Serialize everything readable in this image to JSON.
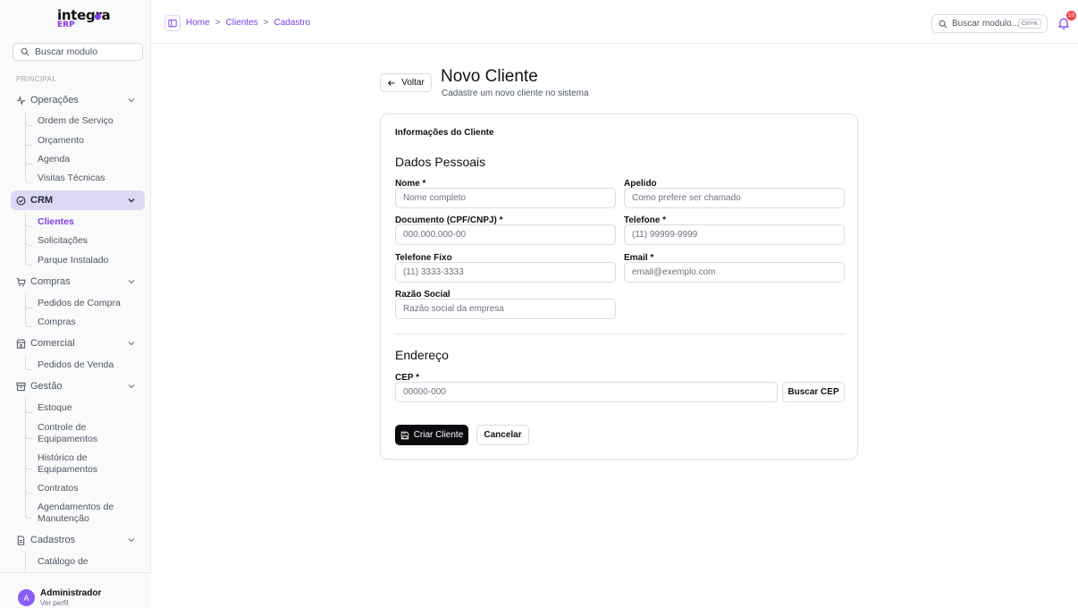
{
  "logo": {
    "name": "integra",
    "sub": "ERP"
  },
  "sidebar": {
    "search_placeholder": "Buscar modulo",
    "section_title": "PRINCIPAL",
    "groups": [
      {
        "label": "Operações",
        "icon": "activity-icon"
      },
      {
        "label": "CRM",
        "icon": "circle-check-icon"
      },
      {
        "label": "Compras",
        "icon": "cart-icon"
      },
      {
        "label": "Comercial",
        "icon": "store-icon"
      },
      {
        "label": "Gestão",
        "icon": "archive-icon"
      },
      {
        "label": "Cadastros",
        "icon": "document-icon"
      }
    ],
    "items": {
      "operacoes": [
        "Ordem de Serviço",
        "Orçamento",
        "Agenda",
        "Visitas Técnicas"
      ],
      "crm": [
        "Clientes",
        "Solicitações",
        "Parque Instalado"
      ],
      "compras": [
        "Pedidos de Compra",
        "Compras"
      ],
      "comercial": [
        "Pedidos de Venda"
      ],
      "gestao": [
        "Estoque",
        "Controle de Equipamentos",
        "Histórico de Equipamentos",
        "Contratos",
        "Agendamentos de Manutenção"
      ],
      "cadastros": [
        "Catálogo de"
      ]
    },
    "user": {
      "initial": "A",
      "name": "Administrador",
      "sub": "Ver perfil"
    }
  },
  "header": {
    "breadcrumb": [
      "Home",
      "Clientes",
      "Cadastro"
    ],
    "separator": ">",
    "search_placeholder": "Buscar modulo...",
    "shortcut": "Ctrl+K",
    "notifications": "10"
  },
  "page": {
    "back": "Voltar",
    "title": "Novo Cliente",
    "subtitle": "Cadastre um novo cliente no sistema"
  },
  "form": {
    "card_title": "Informações do Cliente",
    "personal_title": "Dados Pessoais",
    "fields": {
      "nome": {
        "label": "Nome *",
        "placeholder": "Nome completo"
      },
      "apelido": {
        "label": "Apelido",
        "placeholder": "Como prefere ser chamado"
      },
      "documento": {
        "label": "Documento (CPF/CNPJ) *",
        "placeholder": "000.000.000-00"
      },
      "telefone": {
        "label": "Telefone *",
        "placeholder": "(11) 99999-9999"
      },
      "telefone_fixo": {
        "label": "Telefone Fixo",
        "placeholder": "(11) 3333-3333"
      },
      "email": {
        "label": "Email *",
        "placeholder": "email@exemplo.com"
      },
      "razao_social": {
        "label": "Razão Social",
        "placeholder": "Razão social da empresa"
      },
      "cep": {
        "label": "CEP *",
        "placeholder": "00000-000"
      }
    },
    "address_title": "Endereço",
    "buscar_cep": "Buscar CEP",
    "submit": "Criar Cliente",
    "cancel": "Cancelar"
  },
  "colors": {
    "accent": "#7c3aed",
    "active_bg": "#ddd8f6",
    "primary_button": "#0b0b0f",
    "badge": "#ef4444"
  }
}
